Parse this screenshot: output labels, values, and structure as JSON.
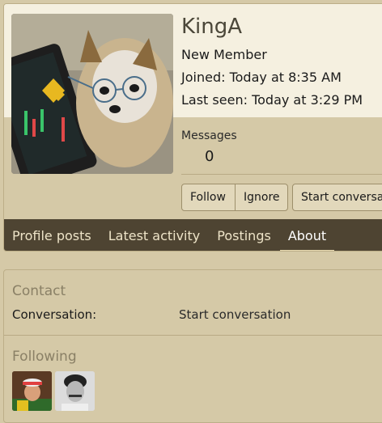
{
  "profile": {
    "username": "KingA",
    "user_title": "New Member",
    "joined_label": "Joined:",
    "joined_value": "Today at 8:35 AM",
    "last_seen_label": "Last seen:",
    "last_seen_value": "Today at 3:29 PM",
    "messages_label": "Messages",
    "messages_value": "0",
    "avatar_icon": "dog-with-glasses-avatar"
  },
  "actions": {
    "follow_label": "Follow",
    "ignore_label": "Ignore",
    "conversation_label": "Start conversation"
  },
  "tabs": [
    {
      "label": "Profile posts"
    },
    {
      "label": "Latest activity"
    },
    {
      "label": "Postings"
    },
    {
      "label": "About"
    }
  ],
  "active_tab": "About",
  "about": {
    "contact_heading": "Contact",
    "conversation_label": "Conversation:",
    "conversation_value": "Start conversation",
    "following_heading": "Following",
    "following_icons": [
      "follower-avatar-cap-man",
      "follower-avatar-mustache-man"
    ]
  },
  "colors": {
    "background": "#d5c9a7",
    "header": "#f5f0e0",
    "tab_bar": "#4e4432",
    "accent": "#eadcb4"
  }
}
